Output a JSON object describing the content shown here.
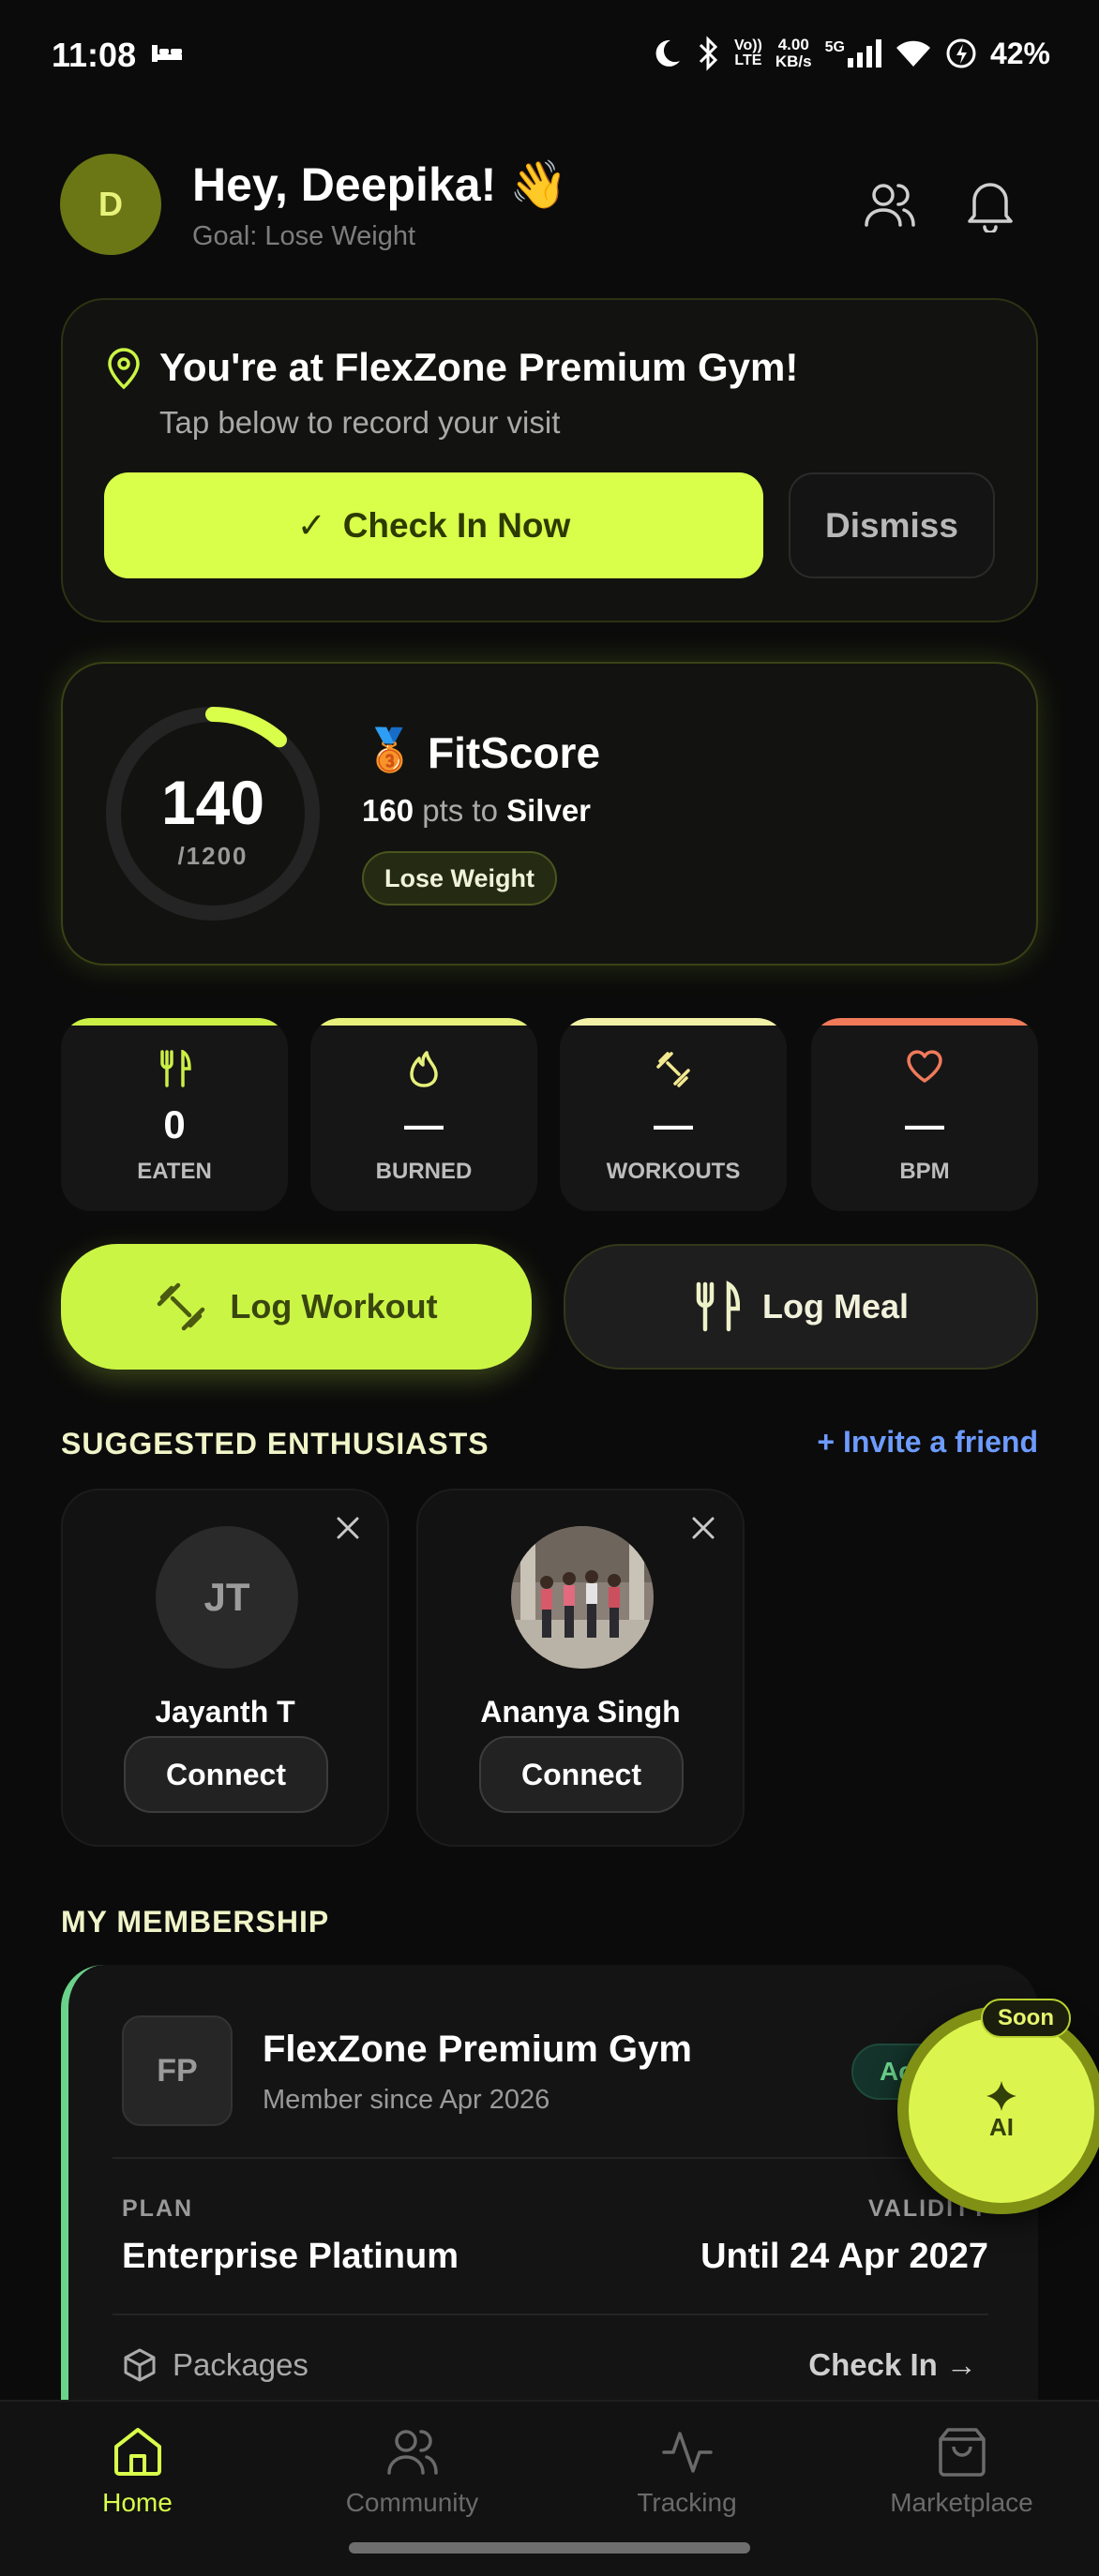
{
  "status": {
    "time": "11:08",
    "net_rate": "4.00",
    "net_unit": "KB/s",
    "network": "5G",
    "battery": "42%"
  },
  "header": {
    "avatar_initial": "D",
    "greeting": "Hey, Deepika! 👋",
    "goal": "Goal: Lose Weight"
  },
  "checkin": {
    "title": "You're at FlexZone Premium Gym!",
    "subtitle": "Tap below to record your visit",
    "button": "Check In Now",
    "button_icon": "✓",
    "dismiss": "Dismiss"
  },
  "fitscore": {
    "score": "140",
    "max": "/1200",
    "progress": 0.1167,
    "title": "FitScore",
    "medal": "🥉",
    "pts": "160",
    "pts_text": "pts to",
    "tier": "Silver",
    "badge": "Lose Weight"
  },
  "stats": [
    {
      "label": "EATEN",
      "value": "0",
      "icon": "fork-knife-icon",
      "color": "#cbef45"
    },
    {
      "label": "BURNED",
      "value": "—",
      "icon": "flame-icon",
      "color": "#e6f07a"
    },
    {
      "label": "WORKOUTS",
      "value": "—",
      "icon": "dumbbell-icon",
      "color": "#f3f0a8"
    },
    {
      "label": "BPM",
      "value": "—",
      "icon": "heart-icon",
      "color": "#f07a5a"
    }
  ],
  "actions": {
    "log_workout": "Log Workout",
    "log_meal": "Log Meal"
  },
  "suggested": {
    "title": "SUGGESTED ENTHUSIASTS",
    "invite": "+ Invite a friend",
    "people": [
      {
        "initials": "JT",
        "name": "Jayanth T",
        "button": "Connect"
      },
      {
        "initials": "",
        "name": "Ananya Singh",
        "button": "Connect"
      }
    ]
  },
  "membership": {
    "title": "MY MEMBERSHIP",
    "logo": "FP",
    "gym": "FlexZone Premium Gym",
    "since": "Member since Apr 2026",
    "status": "Active",
    "plan_label": "PLAN",
    "plan": "Enterprise Platinum",
    "validity_label": "VALIDITY",
    "validity": "Until 24 Apr 2027",
    "packages": "Packages",
    "checkin": "Check In →"
  },
  "ai": {
    "label": "AI",
    "soon": "Soon"
  },
  "nav": [
    {
      "label": "Home",
      "icon": "home-icon",
      "active": true
    },
    {
      "label": "Community",
      "icon": "community-icon",
      "active": false
    },
    {
      "label": "Tracking",
      "icon": "activity-icon",
      "active": false
    },
    {
      "label": "Marketplace",
      "icon": "shopping-bag-icon",
      "active": false
    }
  ],
  "colors": {
    "accent": "#d9ff4b",
    "background": "#0b0b0b",
    "card": "#121310",
    "membership_stripe": "#6ad28a",
    "link": "#6d9bff"
  }
}
